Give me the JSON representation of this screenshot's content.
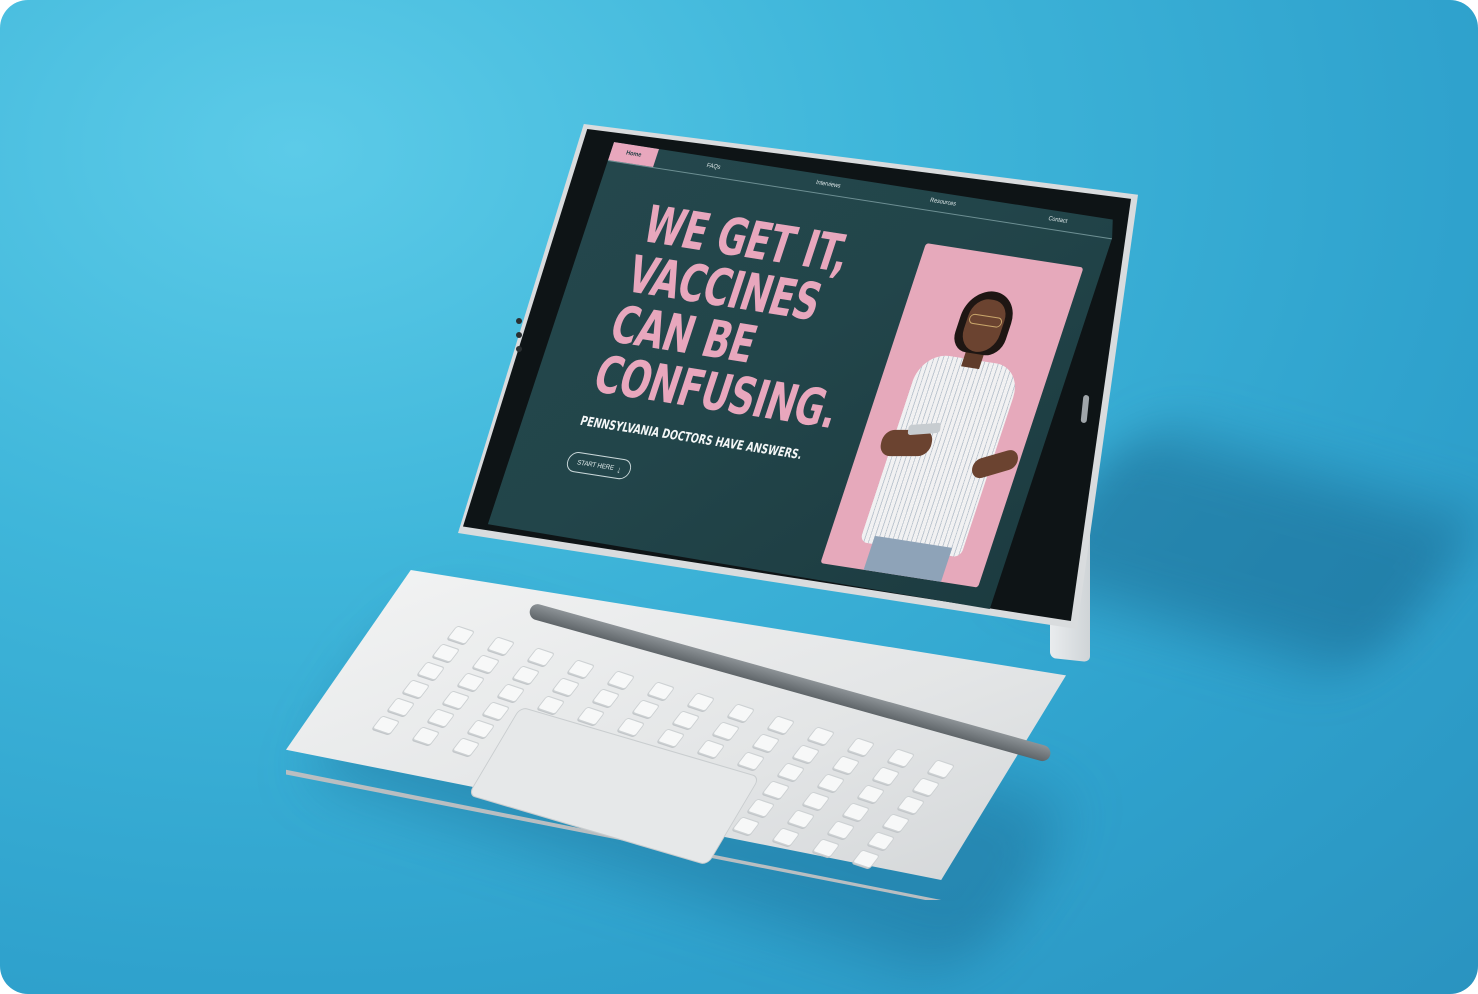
{
  "nav": {
    "items": [
      "Home",
      "FAQs",
      "Interviews",
      "Resources",
      "Contact"
    ],
    "active": "Home"
  },
  "hero": {
    "headline": "WE GET IT,\nVACCINES\nCAN BE\nCONFUSING.",
    "subhead": "PENNSYLVANIA DOCTORS HAVE ANSWERS.",
    "cta_label": "START HERE",
    "cta_icon": "arrow-down-icon"
  },
  "colors": {
    "background": "#3fb6da",
    "screen_bg": "#22454a",
    "accent_pink": "#e8a7bd",
    "text_light": "#f4f7f7"
  }
}
